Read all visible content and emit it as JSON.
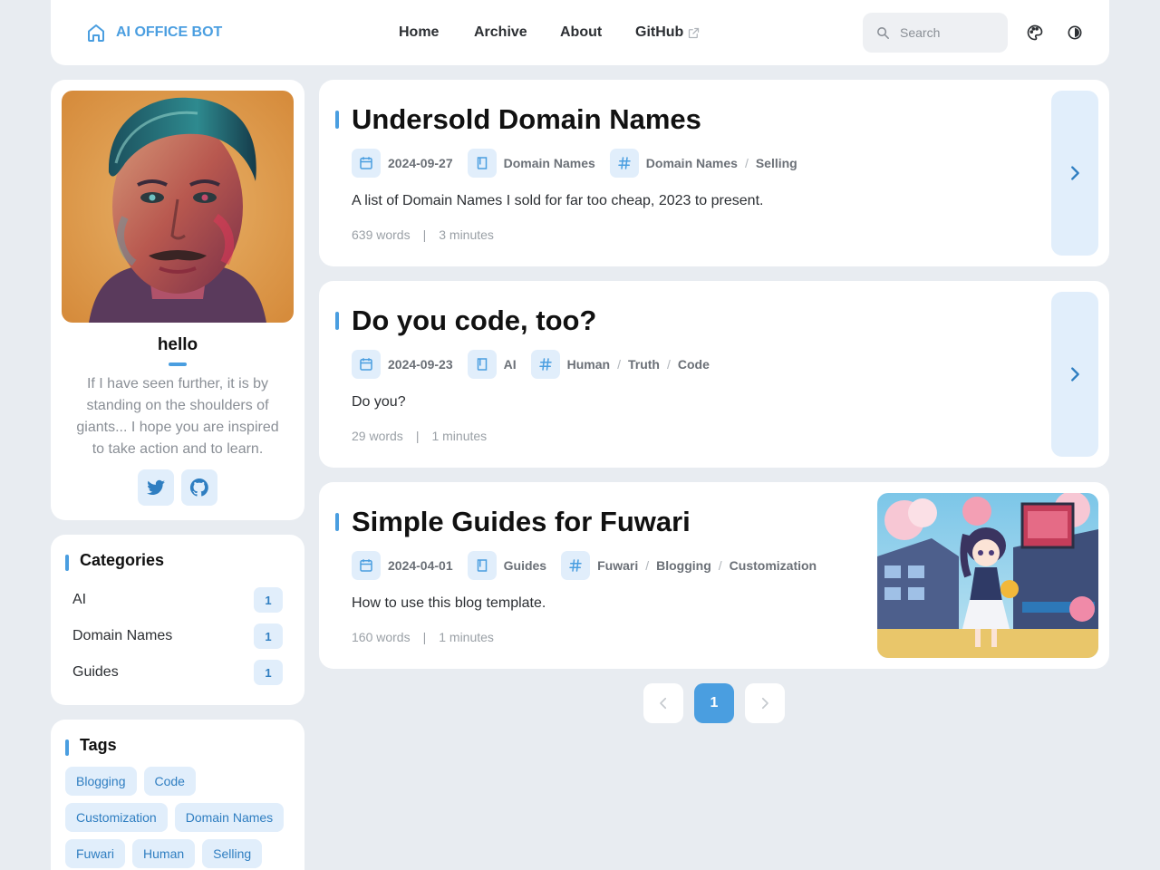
{
  "brand": {
    "name": "AI OFFICE BOT",
    "icon": "home-icon"
  },
  "nav": {
    "home": "Home",
    "archive": "Archive",
    "about": "About",
    "github": "GitHub"
  },
  "search": {
    "placeholder": "Search"
  },
  "profile": {
    "name": "hello",
    "bio": "If I have seen further, it is by standing on the shoulders of giants... I hope you are inspired to take action and to learn.",
    "socials": [
      "twitter-icon",
      "github-icon"
    ]
  },
  "categories": {
    "title": "Categories",
    "items": [
      {
        "label": "AI",
        "count": "1"
      },
      {
        "label": "Domain Names",
        "count": "1"
      },
      {
        "label": "Guides",
        "count": "1"
      }
    ]
  },
  "tags": {
    "title": "Tags",
    "items": [
      "Blogging",
      "Code",
      "Customization",
      "Domain Names",
      "Fuwari",
      "Human",
      "Selling"
    ]
  },
  "posts": [
    {
      "title": "Undersold Domain Names",
      "date": "2024-09-27",
      "category": "Domain Names",
      "tags": [
        "Domain Names",
        "Selling"
      ],
      "description": "A list of Domain Names I sold for far too cheap, 2023 to present.",
      "words": "639 words",
      "time": "3 minutes"
    },
    {
      "title": "Do you code, too?",
      "date": "2024-09-23",
      "category": "AI",
      "tags": [
        "Human",
        "Truth",
        "Code"
      ],
      "description": "Do you?",
      "words": "29 words",
      "time": "1 minutes"
    },
    {
      "title": "Simple Guides for Fuwari",
      "date": "2024-04-01",
      "category": "Guides",
      "tags": [
        "Fuwari",
        "Blogging",
        "Customization"
      ],
      "description": "How to use this blog template.",
      "words": "160 words",
      "time": "1 minutes"
    }
  ],
  "pagination": {
    "current": "1"
  },
  "colors": {
    "accent": "#4a9ee0",
    "accent_light": "#e1eefb",
    "background": "#e8ecf1"
  }
}
